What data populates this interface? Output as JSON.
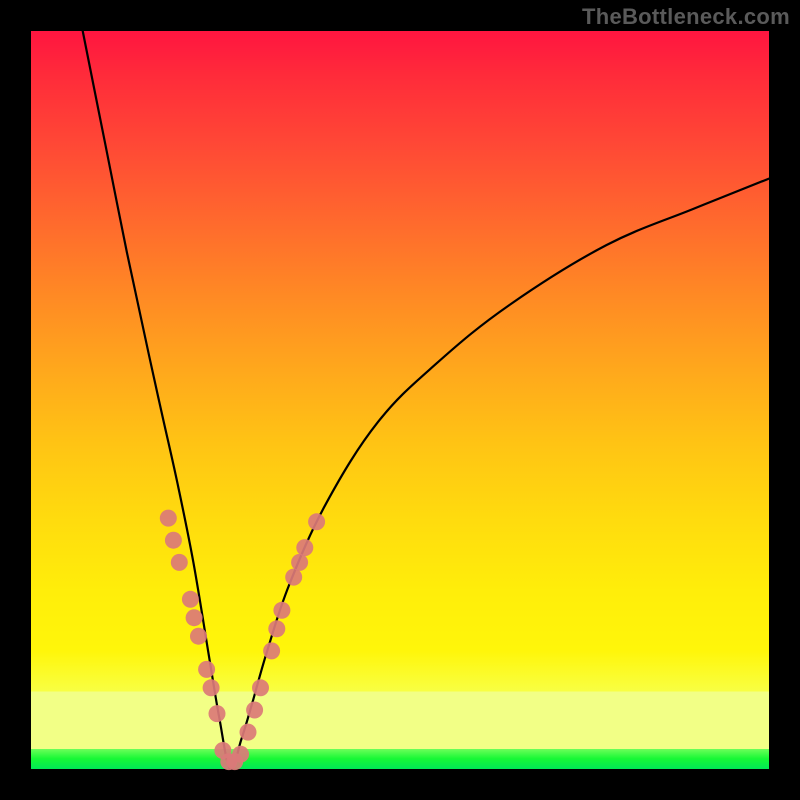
{
  "watermark": "TheBottleneck.com",
  "colors": {
    "frame": "#000000",
    "curve": "#000000",
    "marker": "#db7a78",
    "gradient_top": "#ff1540",
    "gradient_mid": "#ffdb0e",
    "band_pale": "#f2ff86",
    "band_green": "#00e857"
  },
  "chart_data": {
    "type": "line",
    "title": "",
    "xlabel": "",
    "ylabel": "",
    "xlim": [
      0,
      100
    ],
    "ylim": [
      0,
      100
    ],
    "notes": "V-shaped bottleneck curve. x≈27 is the minimum (y≈0). Left arm rises steeply to y≈100 at x≈7; right arm rises to y≈80 at x=100. Markers cluster on both arms between y≈8 and y≈34, plus a flat group at the trough.",
    "series": [
      {
        "name": "bottleneck-curve",
        "x": [
          7,
          10,
          13,
          16,
          18,
          20,
          22,
          24,
          25.5,
          27,
          28.5,
          30,
          32,
          35,
          40,
          47,
          55,
          65,
          78,
          90,
          100
        ],
        "y": [
          100,
          85,
          70,
          56,
          47,
          38,
          28,
          16,
          7,
          0,
          4,
          9,
          16,
          25,
          36,
          47,
          55,
          63,
          71,
          76,
          80
        ]
      }
    ],
    "markers": [
      {
        "x": 18.6,
        "y": 34
      },
      {
        "x": 19.3,
        "y": 31
      },
      {
        "x": 20.1,
        "y": 28
      },
      {
        "x": 21.6,
        "y": 23
      },
      {
        "x": 22.1,
        "y": 20.5
      },
      {
        "x": 22.7,
        "y": 18
      },
      {
        "x": 23.8,
        "y": 13.5
      },
      {
        "x": 24.4,
        "y": 11
      },
      {
        "x": 25.2,
        "y": 7.5
      },
      {
        "x": 26.0,
        "y": 2.5
      },
      {
        "x": 26.8,
        "y": 1.0
      },
      {
        "x": 27.6,
        "y": 1.0
      },
      {
        "x": 28.4,
        "y": 2.0
      },
      {
        "x": 29.4,
        "y": 5
      },
      {
        "x": 30.3,
        "y": 8
      },
      {
        "x": 31.1,
        "y": 11
      },
      {
        "x": 32.6,
        "y": 16
      },
      {
        "x": 33.3,
        "y": 19
      },
      {
        "x": 34.0,
        "y": 21.5
      },
      {
        "x": 35.6,
        "y": 26
      },
      {
        "x": 36.4,
        "y": 28
      },
      {
        "x": 37.1,
        "y": 30
      },
      {
        "x": 38.7,
        "y": 33.5
      }
    ]
  }
}
